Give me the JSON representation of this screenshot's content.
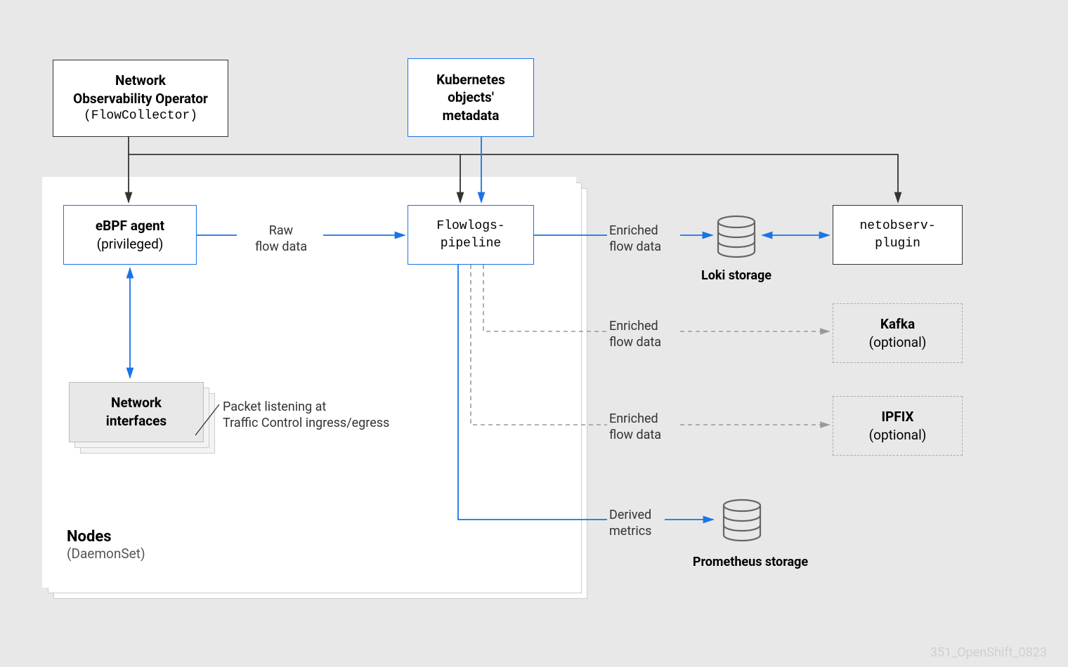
{
  "boxes": {
    "operator": {
      "line1": "Network",
      "line2": "Observability Operator",
      "line3": "(FlowCollector)"
    },
    "k8s": {
      "line1": "Kubernetes",
      "line2": "objects'",
      "line3": "metadata"
    },
    "ebpf": {
      "line1": "eBPF agent",
      "line2": "(privileged)"
    },
    "pipeline": {
      "line1": "Flowlogs-",
      "line2": "pipeline"
    },
    "plugin": {
      "line1": "netobserv-",
      "line2": "plugin"
    },
    "netif": {
      "line1": "Network",
      "line2": "interfaces"
    },
    "kafka": {
      "line1": "Kafka",
      "line2": "(optional)"
    },
    "ipfix": {
      "line1": "IPFIX",
      "line2": "(optional)"
    }
  },
  "labels": {
    "raw": {
      "line1": "Raw",
      "line2": "flow data"
    },
    "enriched1": {
      "line1": "Enriched",
      "line2": "flow data"
    },
    "enriched2": {
      "line1": "Enriched",
      "line2": "flow data"
    },
    "enriched3": {
      "line1": "Enriched",
      "line2": "flow data"
    },
    "derived": {
      "line1": "Derived",
      "line2": "metrics"
    },
    "packet": {
      "line1": "Packet listening at",
      "line2": "Traffic Control ingress/egress"
    },
    "loki": "Loki storage",
    "prometheus": "Prometheus storage"
  },
  "nodes_caption": {
    "line1": "Nodes",
    "line2": "(DaemonSet)"
  },
  "watermark": "351_OpenShift_0823"
}
